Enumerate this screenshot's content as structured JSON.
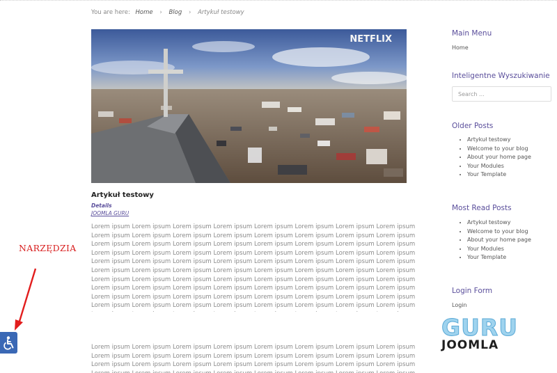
{
  "breadcrumb": {
    "lead": "You are here:",
    "items": [
      "Home",
      "Blog",
      "Artykuł testowy"
    ]
  },
  "hero": {
    "watermark": "NETFLIX"
  },
  "article": {
    "title": "Artykuł testowy",
    "details_label": "Details",
    "author": "JOOMLA GURU",
    "paragraph_1": "Lorem ipsum Lorem ipsum Lorem ipsum Lorem ipsum Lorem ipsum Lorem ipsum Lorem ipsum Lorem ipsum Lorem ipsum Lorem ipsum Lorem ipsum Lorem ipsum Lorem ipsum Lorem ipsum Lorem ipsum Lorem ipsum Lorem ipsum Lorem ipsum Lorem ipsum Lorem ipsum Lorem ipsum Lorem ipsum Lorem ipsum Lorem ipsum Lorem ipsum Lorem ipsum Lorem ipsum Lorem ipsum Lorem ipsum Lorem ipsum Lorem ipsum Lorem ipsum Lorem ipsum Lorem ipsum Lorem ipsum Lorem ipsum Lorem ipsum Lorem ipsum Lorem ipsum Lorem ipsum Lorem ipsum Lorem ipsum Lorem ipsum Lorem ipsum Lorem ipsum Lorem ipsum Lorem ipsum Lorem ipsum Lorem ipsum Lorem ipsum Lorem ipsum Lorem ipsum Lorem ipsum Lorem ipsum Lorem ipsum Lorem ipsum Lorem ipsum Lorem ipsum Lorem ipsum Lorem ipsum Lorem ipsum Lorem ipsum Lorem ipsum Lorem ipsum Lorem ipsum Lorem ipsum Lorem ipsum Lorem ipsum Lorem ipsum Lorem ipsum Lorem ipsum Lorem ipsum Lorem ipsum Lorem ipsum Lorem ipsum Lorem ipsum Lorem ipsum Lorem ipsum Lorem ipsum Lorem ipsum Lorem ipsum Lorem ipsum Lorem ipsum Lorem ipsum Lorem ipsum Lorem ipsum Lorem ipsum Lorem ipsum Lorem ipsum Lorem ipsum Lorem ipsum Lorem ipsum Lorem ipsum Lorem ipsum Lorem ipsum Lorem ipsum Lorem ipsum",
    "paragraph_2": "Lorem ipsum Lorem ipsum Lorem ipsum Lorem ipsum Lorem ipsum Lorem ipsum Lorem ipsum Lorem ipsum Lorem ipsum Lorem ipsum Lorem ipsum Lorem ipsum Lorem ipsum Lorem ipsum Lorem ipsum Lorem ipsum Lorem ipsum Lorem ipsum Lorem ipsum Lorem ipsum Lorem ipsum Lorem ipsum Lorem ipsum Lorem ipsum Lorem ipsum Lorem ipsum Lorem ipsum Lorem ipsum Lorem ipsum Lorem ipsum Lorem ipsum Lorem ipsum Lorem ipsum Lorem ipsum Lorem ipsum Lorem ipsum"
  },
  "sidebar": {
    "main_menu": {
      "title": "Main Menu",
      "items": [
        "Home"
      ]
    },
    "search": {
      "title": "Inteligentne Wyszukiwanie",
      "placeholder": "Search ..."
    },
    "older_posts": {
      "title": "Older Posts",
      "items": [
        "Artykuł testowy",
        "Welcome to your blog",
        "About your home page",
        "Your Modules",
        "Your Template"
      ]
    },
    "most_read": {
      "title": "Most Read Posts",
      "items": [
        "Artykuł testowy",
        "Welcome to your blog",
        "About your home page",
        "Your Modules",
        "Your Template"
      ]
    },
    "login": {
      "title": "Login Form",
      "link": "Login"
    }
  },
  "logo": {
    "line1": "GURU",
    "line2": "JOOMLA"
  },
  "tools": {
    "label": "NARZĘDZIA"
  },
  "colors": {
    "accent": "#5a4e9b",
    "annotation": "#d81f1f",
    "a11y": "#3a68b5"
  }
}
